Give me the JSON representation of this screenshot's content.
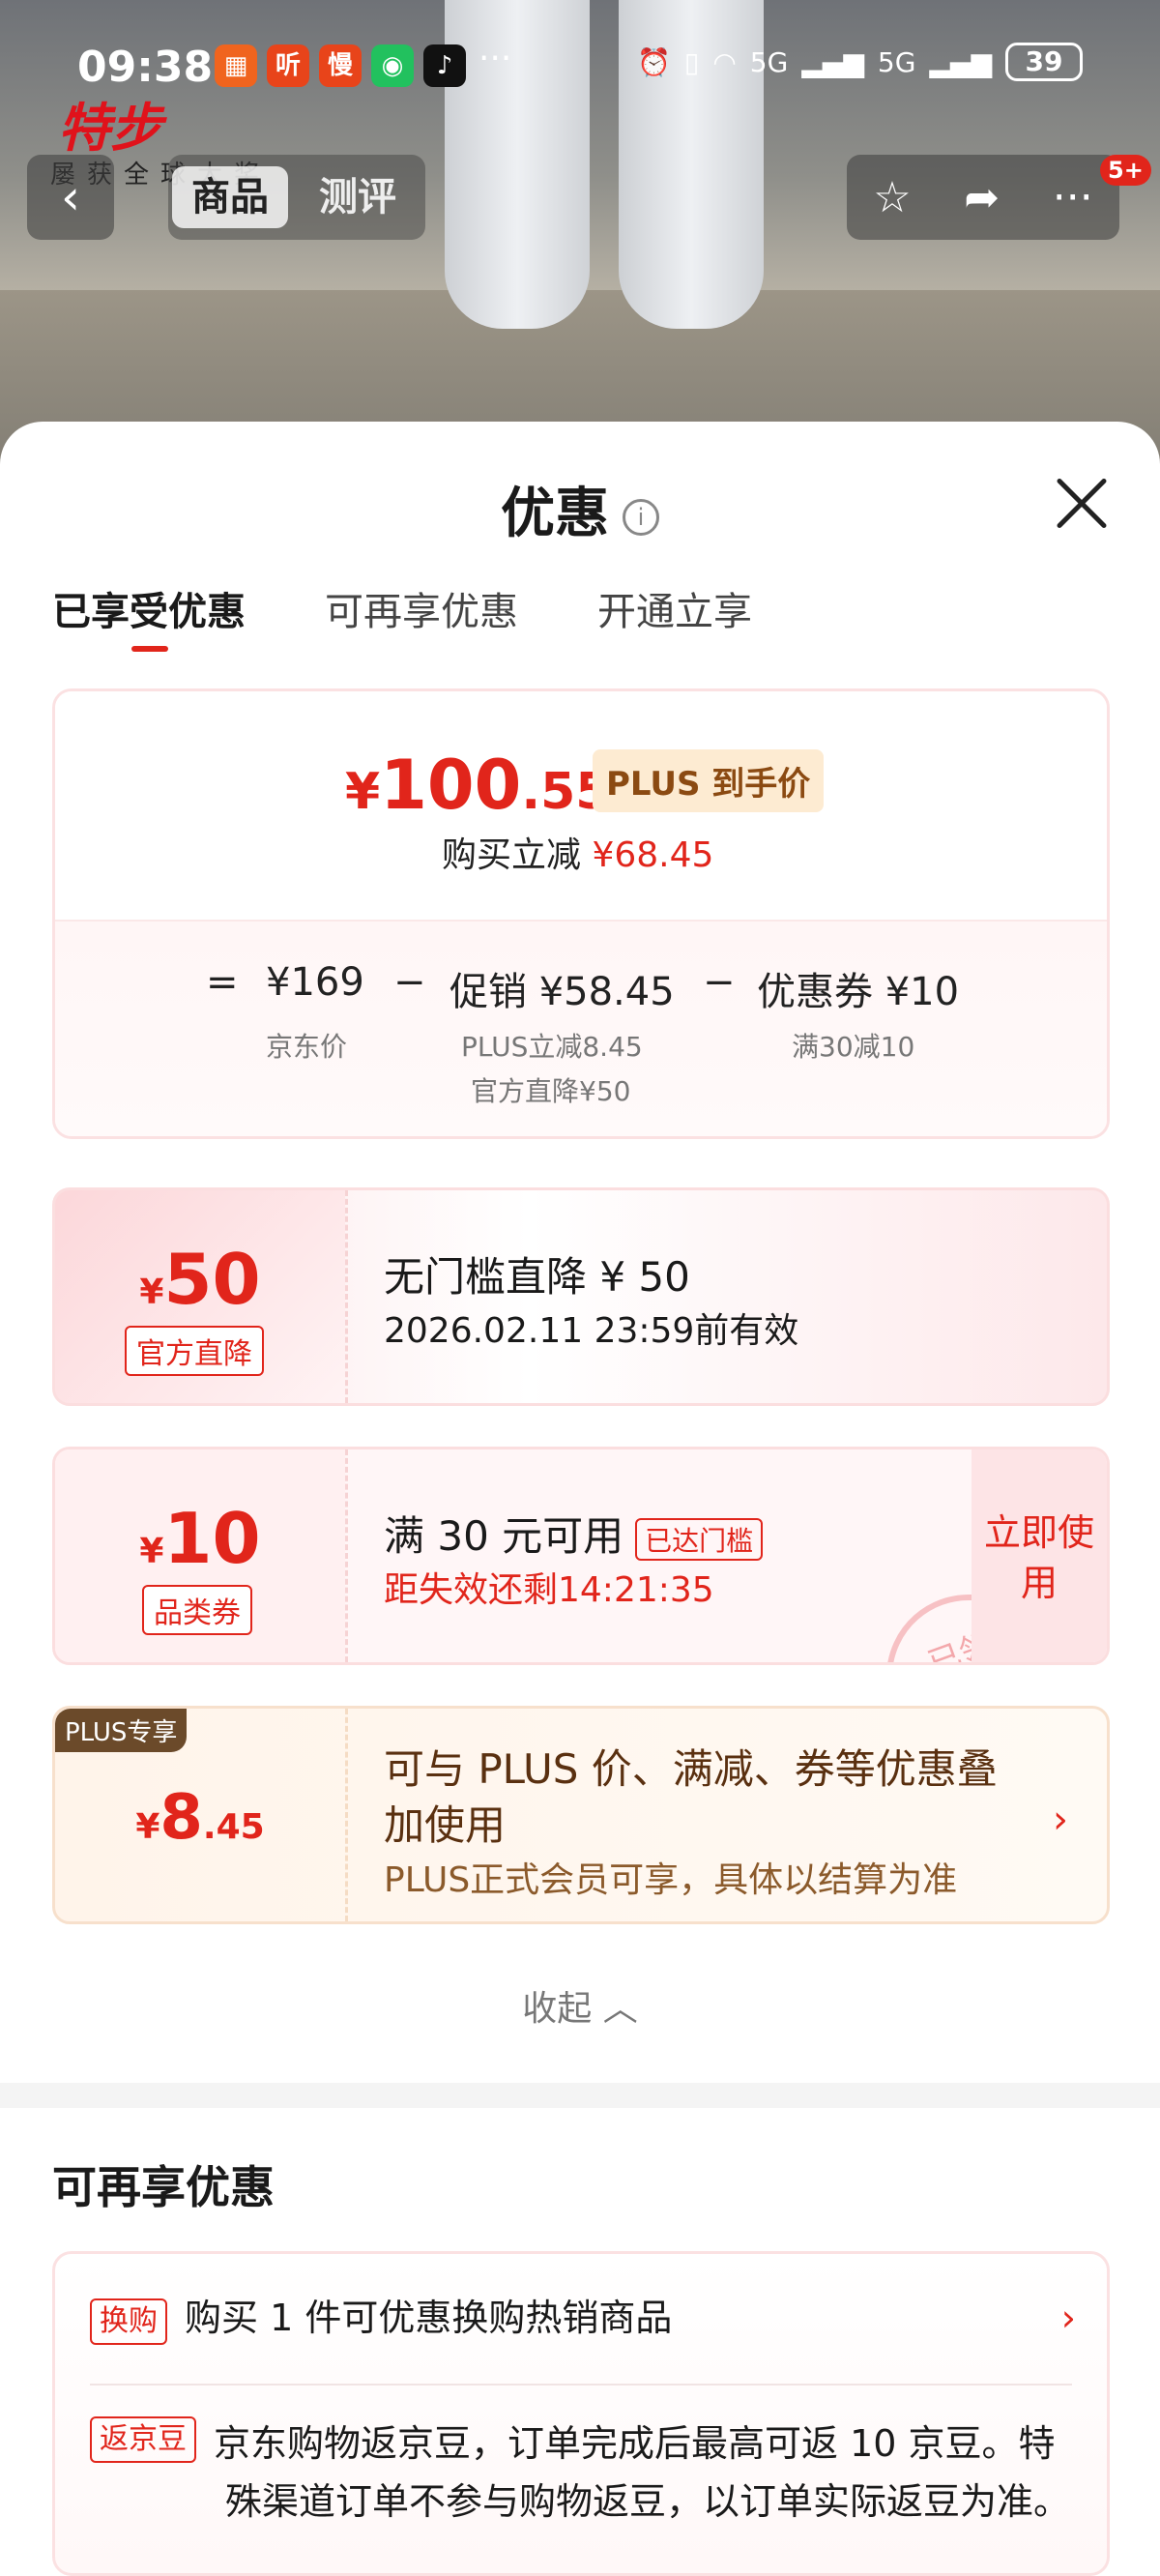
{
  "status": {
    "time": "09:38",
    "battery": "39",
    "more": "···",
    "net1": "5G",
    "net2": "5G"
  },
  "apps": [
    "听",
    "慢"
  ],
  "header": {
    "brand": "特步",
    "brand_sub": "屡获全球大奖",
    "tab_goods": "商品",
    "tab_review": "测评",
    "msg_badge": "5+"
  },
  "sheet": {
    "title": "优惠",
    "info": "i"
  },
  "tabs": [
    "已享受优惠",
    "可再享优惠",
    "开通立享"
  ],
  "price": {
    "yen": "¥",
    "int": "100",
    "dec": ".55",
    "tag": "PLUS 到手价",
    "reduce_label": "购买立减",
    "reduce_value": "¥68.45",
    "eq": "=",
    "base": "¥169",
    "minus1": "−",
    "promo": "促销 ¥58.45",
    "minus2": "−",
    "coupon": "优惠券 ¥10",
    "base_label": "京东价",
    "promo_label1": "PLUS立减8.45",
    "promo_label2": "官方直降¥50",
    "coupon_label": "满30减10"
  },
  "card1": {
    "yen": "¥",
    "amount": "50",
    "tag": "官方直降",
    "title": "无门槛直降 ¥ 50",
    "valid": "2026.02.11 23:59前有效"
  },
  "card2": {
    "yen": "¥",
    "amount": "10",
    "tag": "品类券",
    "title": "满 30 元可用",
    "reached": "已达门槛",
    "countdown": "距失效还剩14:21:35",
    "use": "立即使用",
    "stamp": "已领"
  },
  "card3": {
    "corner": "PLUS专享",
    "yen": "¥",
    "amount": "8",
    "dec": ".45",
    "text": "可与 PLUS 价、满减、券等优惠叠加使用",
    "sub": "PLUS正式会员可享，具体以结算为准",
    "chev": "›"
  },
  "collapse": "收起 ︿",
  "more": {
    "title": "可再享优惠",
    "row1_tag": "换购",
    "row1_text": "购买 1 件可优惠换购热销商品",
    "row2_tag": "返京豆",
    "row2_text_a": "京东购物返京豆，订单完成后最高可返 10 京豆。特",
    "row2_text_b": "殊渠道订单不参与购物返豆，以订单实际返豆为准。"
  }
}
